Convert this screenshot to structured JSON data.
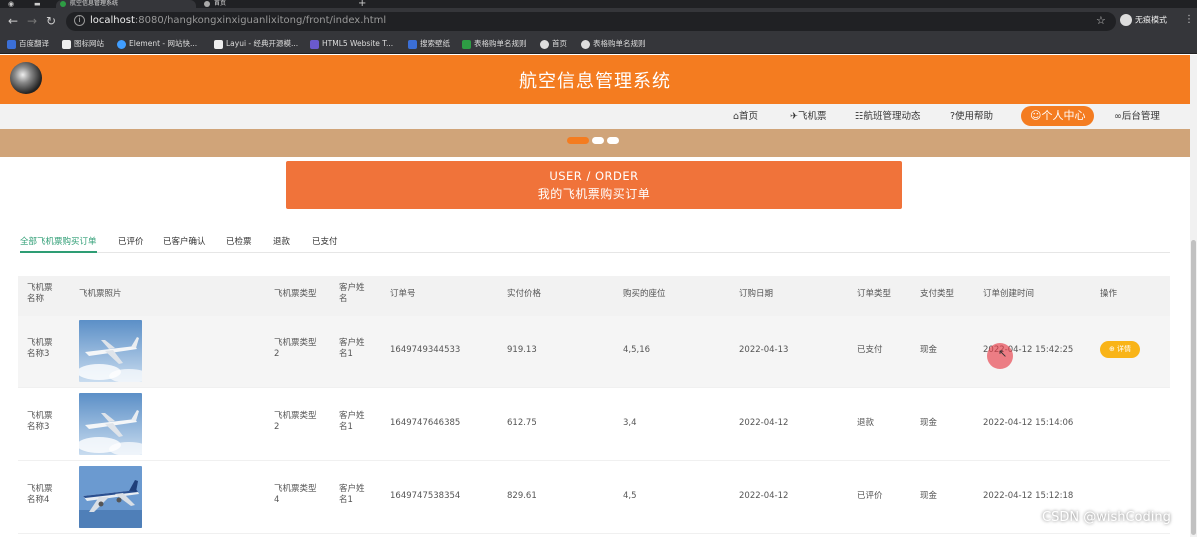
{
  "browser": {
    "tabs": [
      {
        "title": "航空信息管理系统",
        "active": true
      },
      {
        "title": "首页",
        "active": false
      }
    ],
    "url_host": "localhost",
    "url_rest": ":8080/hangkongxinxiguanlixitong/front/index.html",
    "profile_label": "无痕模式",
    "bookmarks": [
      {
        "label": "百度翻译",
        "color": "#3b6fd6"
      },
      {
        "label": "图标网站",
        "color": "#eee"
      },
      {
        "label": "Element - 网站快...",
        "color": "#409eff"
      },
      {
        "label": "Layui - 经典开源模...",
        "color": "#eee"
      },
      {
        "label": "HTML5 Website T...",
        "color": "#6a5acd"
      },
      {
        "label": "搜索壁纸",
        "color": "#3b6fd6"
      },
      {
        "label": "表格购单名规则",
        "color": "#2e9d44"
      },
      {
        "label": "首页",
        "color": "#ddd"
      },
      {
        "label": "表格购单名规则",
        "color": "#ddd"
      }
    ]
  },
  "site": {
    "title": "航空信息管理系统",
    "accent": "#f47c20"
  },
  "nav": {
    "items": [
      {
        "icon": "home-icon",
        "glyph": "⌂",
        "label": "首页"
      },
      {
        "icon": "plane-icon",
        "glyph": "✈",
        "label": "飞机票"
      },
      {
        "icon": "news-icon",
        "glyph": "☷",
        "label": "航班管理动态"
      },
      {
        "icon": "help-icon",
        "glyph": "?",
        "label": "使用帮助"
      },
      {
        "icon": "user-icon",
        "glyph": "☺",
        "label": "个人中心",
        "active": true
      },
      {
        "icon": "link-icon",
        "glyph": "∞",
        "label": "后台管理"
      }
    ]
  },
  "order_title": {
    "en": "USER / ORDER",
    "cn": "我的飞机票购买订单"
  },
  "tabs": [
    {
      "label": "全部飞机票购买订单",
      "active": true
    },
    {
      "label": "已评价"
    },
    {
      "label": "已客户确认"
    },
    {
      "label": "已检票"
    },
    {
      "label": "退款"
    },
    {
      "label": "已支付"
    }
  ],
  "table": {
    "headers": [
      "飞机票\n名称",
      "飞机票照片",
      "飞机票类型",
      "客户姓\n名",
      "订单号",
      "实付价格",
      "购买的座位",
      "订购日期",
      "订单类型",
      "支付类型",
      "订单创建时间",
      "操作"
    ],
    "rows": [
      {
        "name": "飞机票\n名称3",
        "type": "飞机票类型\n2",
        "customer": "客户姓\n名1",
        "order_no": "1649749344533",
        "price": "919.13",
        "seats": "4,5,16",
        "date": "2022-04-13",
        "order_type": "已支付",
        "pay_type": "现金",
        "created": "2022-04-12 15:42:25",
        "action": "详情"
      },
      {
        "name": "飞机票\n名称3",
        "type": "飞机票类型\n2",
        "customer": "客户姓\n名1",
        "order_no": "1649747646385",
        "price": "612.75",
        "seats": "3,4",
        "date": "2022-04-12",
        "order_type": "退款",
        "pay_type": "现金",
        "created": "2022-04-12 15:14:06",
        "action": ""
      },
      {
        "name": "飞机票\n名称4",
        "type": "飞机票类型\n4",
        "customer": "客户姓\n名1",
        "order_no": "1649747538354",
        "price": "829.61",
        "seats": "4,5",
        "date": "2022-04-12",
        "order_type": "已评价",
        "pay_type": "现金",
        "created": "2022-04-12 15:12:18",
        "action": ""
      }
    ]
  },
  "watermark": "CSDN @wishCoding"
}
